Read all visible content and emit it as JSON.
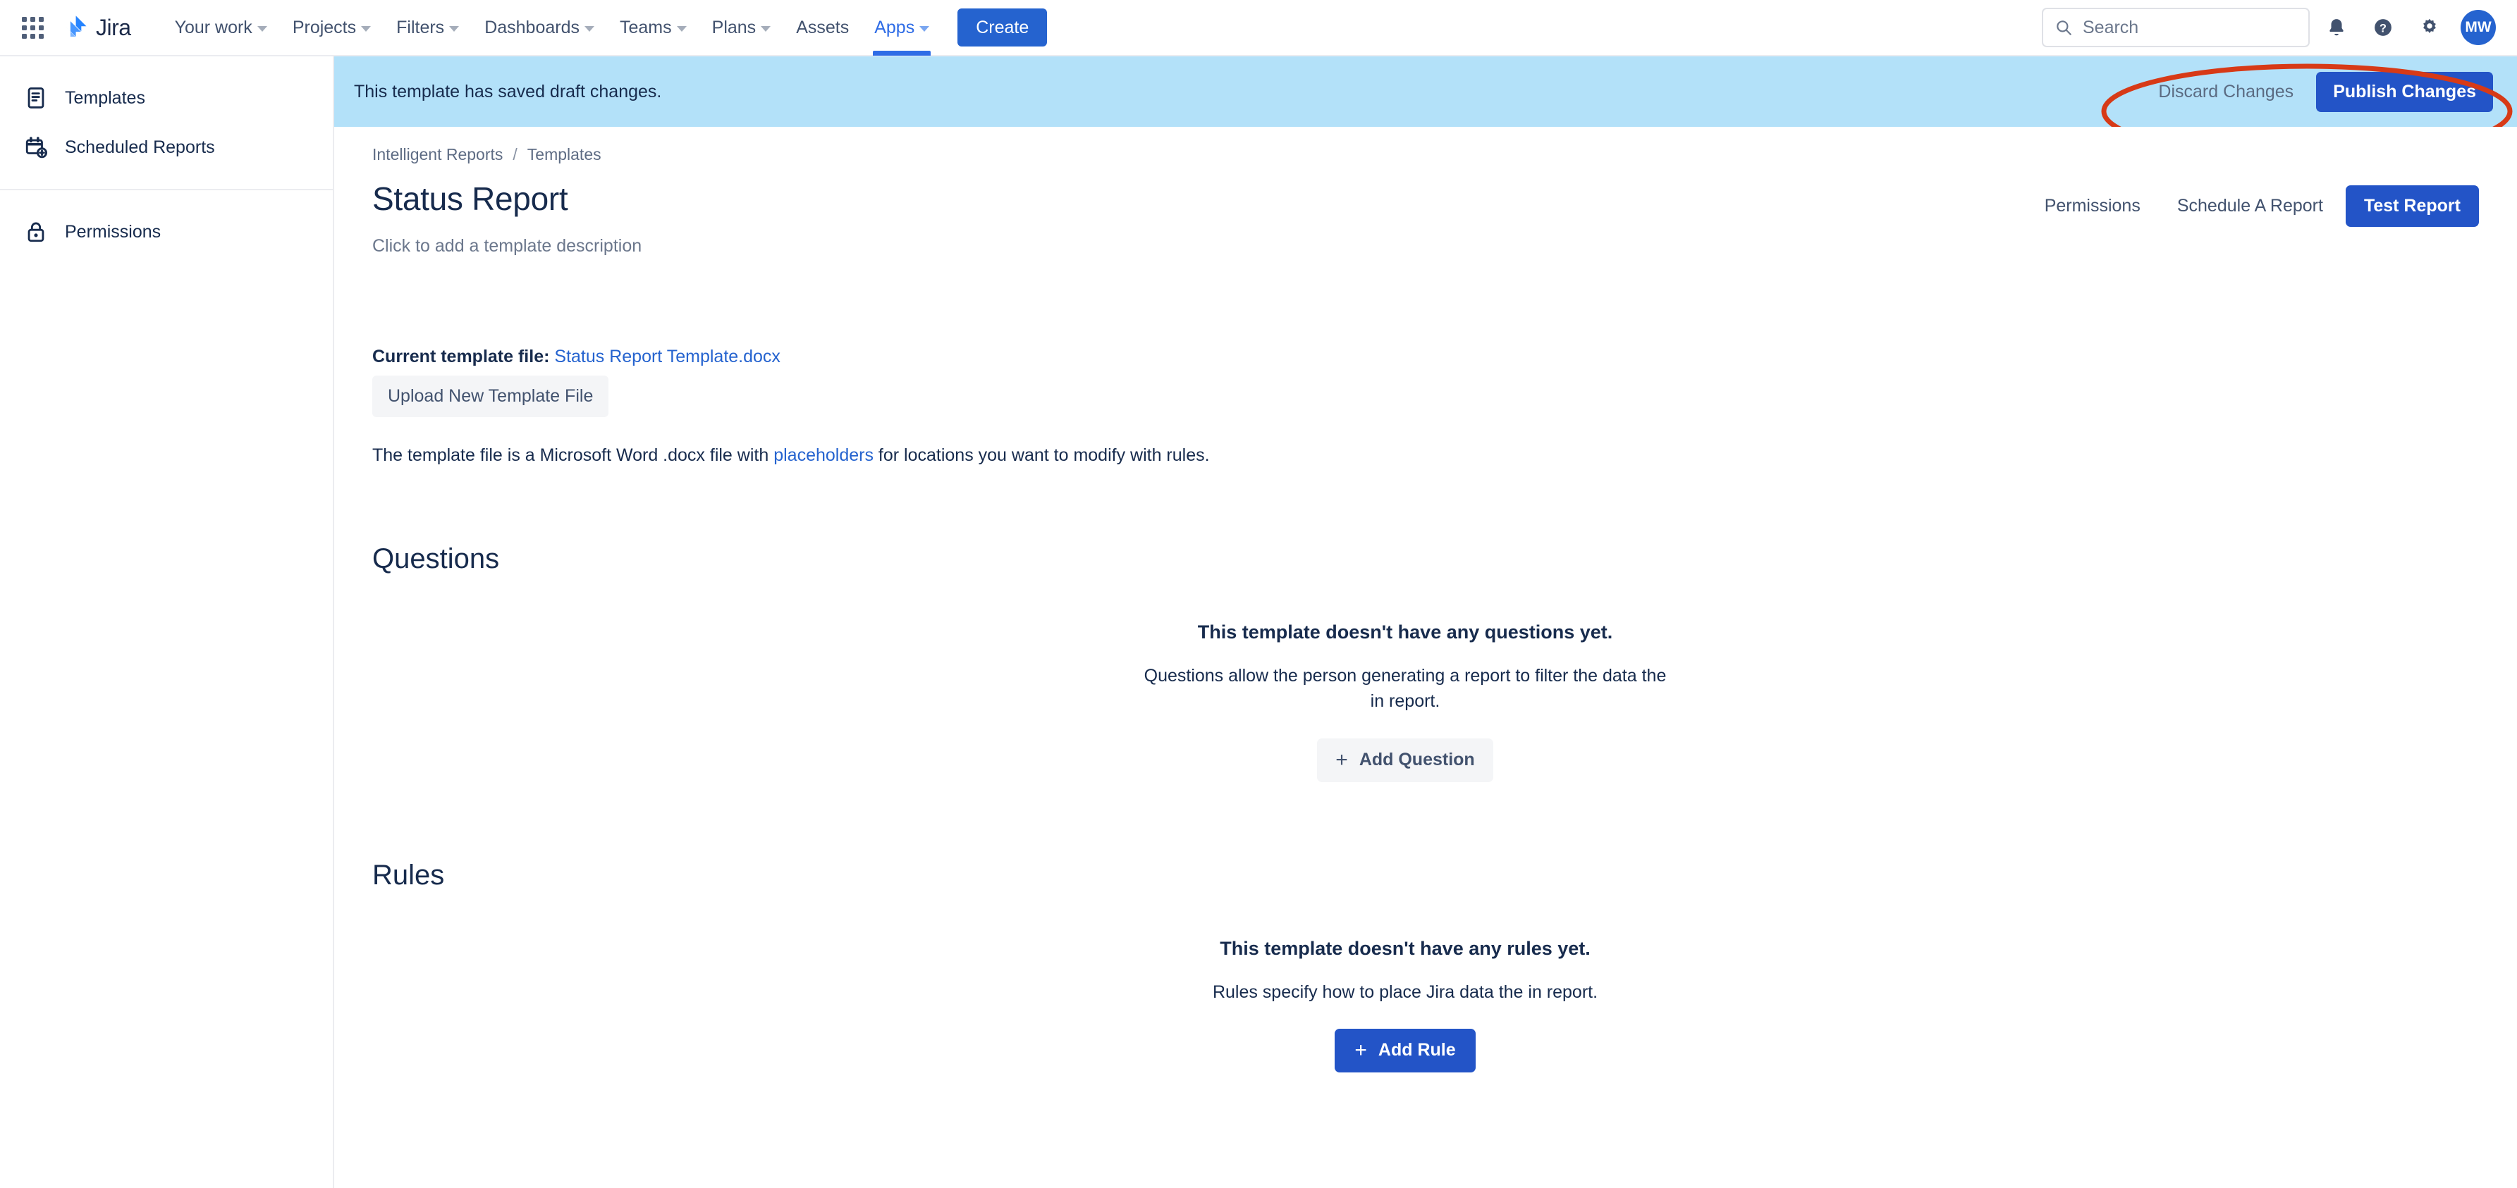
{
  "topnav": {
    "app_switcher_icon": "grid-apps-icon",
    "brand": "Jira",
    "items": [
      {
        "label": "Your work",
        "has_chevron": true,
        "active": false
      },
      {
        "label": "Projects",
        "has_chevron": true,
        "active": false
      },
      {
        "label": "Filters",
        "has_chevron": true,
        "active": false
      },
      {
        "label": "Dashboards",
        "has_chevron": true,
        "active": false
      },
      {
        "label": "Teams",
        "has_chevron": true,
        "active": false
      },
      {
        "label": "Plans",
        "has_chevron": true,
        "active": false
      },
      {
        "label": "Assets",
        "has_chevron": false,
        "active": false
      },
      {
        "label": "Apps",
        "has_chevron": true,
        "active": true
      }
    ],
    "create_label": "Create",
    "search_placeholder": "Search",
    "icons": [
      "search-icon",
      "notifications-bell-icon",
      "help-icon",
      "settings-gear-icon"
    ],
    "avatar_initials": "MW"
  },
  "sidebar": {
    "items": [
      {
        "label": "Templates",
        "icon": "template-document-icon"
      },
      {
        "label": "Scheduled Reports",
        "icon": "calendar-add-icon"
      },
      {
        "label": "Permissions",
        "icon": "lock-icon"
      }
    ]
  },
  "banner": {
    "message": "This template has saved draft changes.",
    "discard_label": "Discard Changes",
    "publish_label": "Publish Changes",
    "background_color": "#b3e1f9"
  },
  "annotation": {
    "shape": "ellipse",
    "color": "#d73a17",
    "targets": "Discard Changes and Publish Changes buttons"
  },
  "breadcrumb": {
    "items": [
      "Intelligent Reports",
      "Templates"
    ],
    "separator": "/"
  },
  "page": {
    "title": "Status Report",
    "description_placeholder": "Click to add a template description",
    "actions": {
      "permissions_label": "Permissions",
      "schedule_label": "Schedule A Report",
      "test_report_label": "Test Report"
    }
  },
  "template_file": {
    "label": "Current template file:",
    "filename": "Status Report Template.docx",
    "upload_label": "Upload New Template File",
    "note_prefix": "The template file is a Microsoft Word .docx file with ",
    "note_link": "placeholders",
    "note_suffix": " for locations you want to modify with rules."
  },
  "questions": {
    "heading": "Questions",
    "empty_title": "This template doesn't have any questions yet.",
    "empty_body": "Questions allow the person generating a report to filter the data the in report.",
    "add_label": "Add Question",
    "add_icon": "plus-icon"
  },
  "rules": {
    "heading": "Rules",
    "empty_title": "This template doesn't have any rules yet.",
    "empty_body": "Rules specify how to place Jira data the in report.",
    "add_label": "Add Rule",
    "add_icon": "plus-icon"
  },
  "colors": {
    "primary_blue": "#2354c7",
    "link_blue": "#2563cf",
    "banner_blue": "#b3e1f9",
    "annotation_red": "#d73a17"
  }
}
